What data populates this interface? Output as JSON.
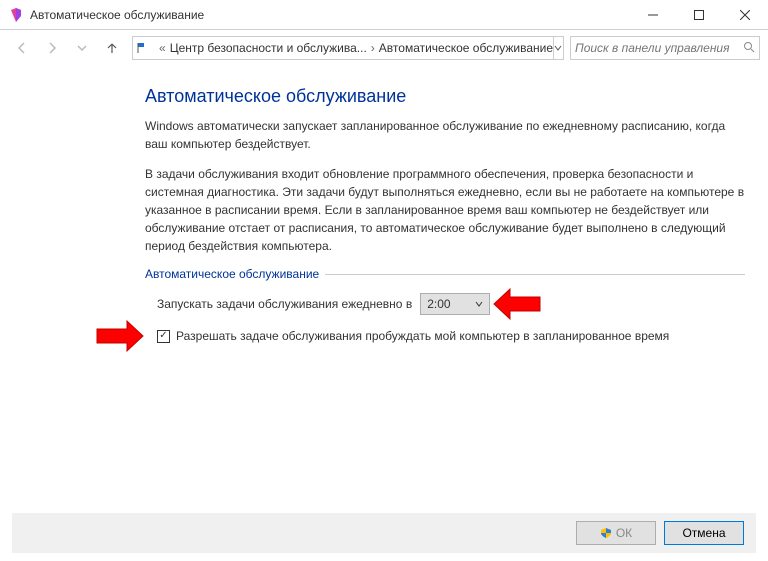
{
  "window": {
    "title": "Автоматическое обслуживание"
  },
  "breadcrumb": {
    "item1": "Центр безопасности и обслужива...",
    "item2": "Автоматическое обслуживание"
  },
  "search": {
    "placeholder": "Поиск в панели управления"
  },
  "page": {
    "heading": "Автоматическое обслуживание",
    "intro": "Windows автоматически запускает запланированное обслуживание по ежедневному расписанию, когда ваш компьютер бездействует.",
    "desc": "В задачи обслуживания входит обновление программного обеспечения, проверка безопасности и системная диагностика. Эти задачи будут выполняться ежедневно, если вы не работаете на компьютере в указанное в расписании время. Если в запланированное время ваш компьютер не бездействует или обслуживание отстает от расписания, то автоматическое обслуживание будет выполнено в следующий период бездействия компьютера."
  },
  "group": {
    "title": "Автоматическое обслуживание",
    "schedule_label": "Запускать задачи обслуживания ежедневно в",
    "time_value": "2:00",
    "wake_label": "Разрешать задаче обслуживания пробуждать мой компьютер в запланированное время",
    "wake_checked": true
  },
  "footer": {
    "ok": "ОК",
    "cancel": "Отмена"
  }
}
